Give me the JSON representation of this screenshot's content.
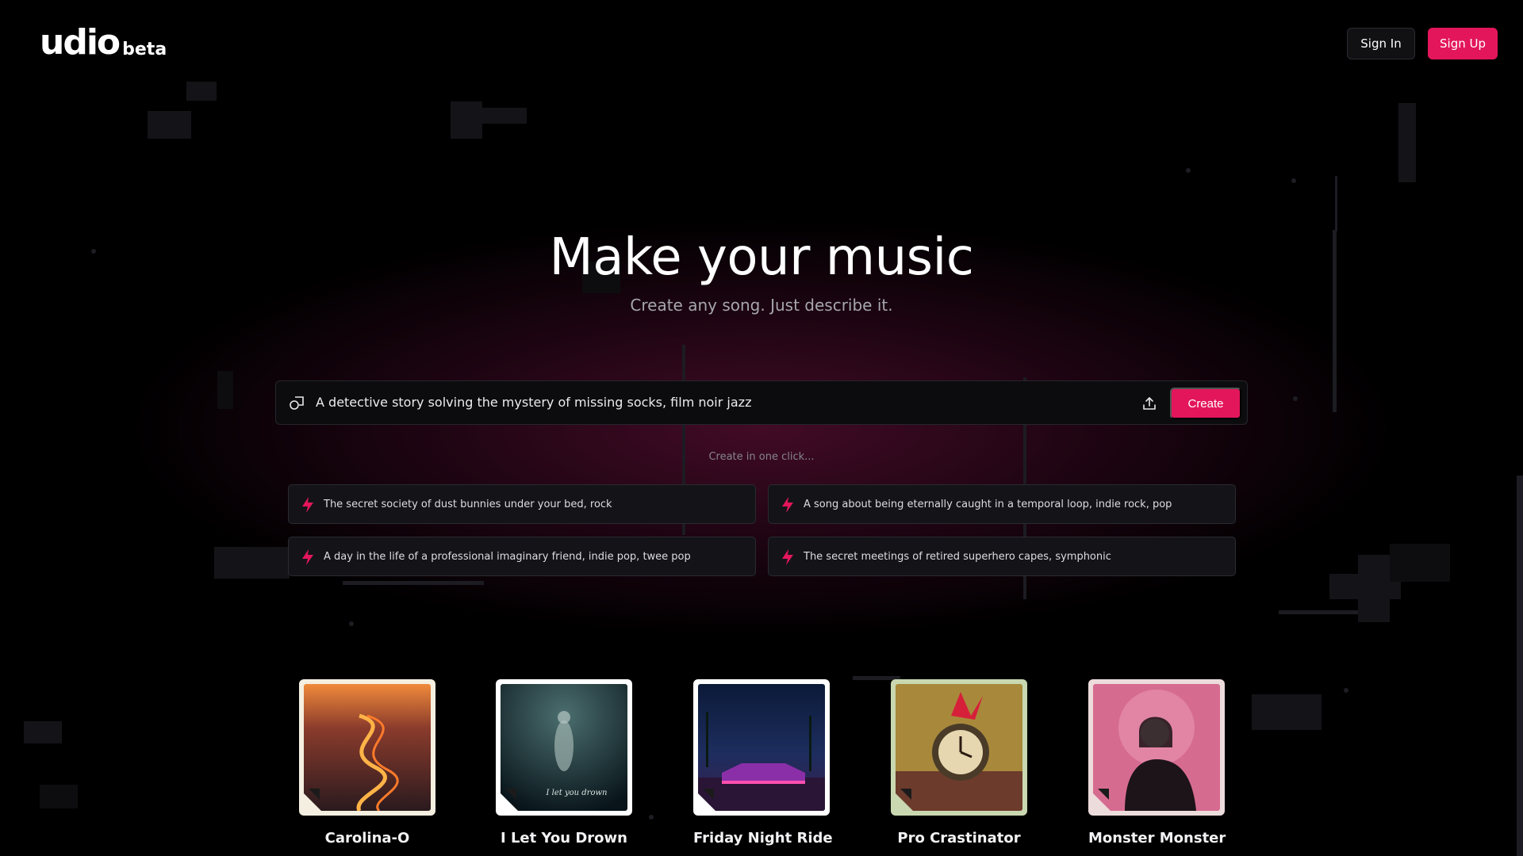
{
  "header": {
    "logo_text": "udio",
    "logo_badge": "beta",
    "signin_label": "Sign In",
    "signup_label": "Sign Up"
  },
  "hero": {
    "title": "Make your music",
    "subtitle": "Create any song. Just describe it."
  },
  "prompt": {
    "value": "A detective story solving the mystery of missing socks, film noir jazz",
    "create_label": "Create"
  },
  "one_click_label": "Create in one click...",
  "suggestions": [
    {
      "text": "The secret society of dust bunnies under your bed, rock"
    },
    {
      "text": "A song about being eternally caught in a temporal loop, indie rock, pop"
    },
    {
      "text": "A day in the life of a professional imaginary friend, indie pop, twee pop"
    },
    {
      "text": "The secret meetings of retired superhero capes, symphonic"
    }
  ],
  "songs": [
    {
      "title": "Carolina-O",
      "artist": "",
      "frame_color": "#f4efe0",
      "cover_top": "#e06a2b",
      "cover_bottom": "#2a1a1e"
    },
    {
      "title": "I Let You Drown",
      "artist": "",
      "frame_color": "#ffffff",
      "cover_top": "#2e4a4c",
      "cover_bottom": "#0b1819",
      "cover_text": "I let you drown"
    },
    {
      "title": "Friday Night Ride",
      "artist": "",
      "frame_color": "#ffffff",
      "cover_top": "#0f2140",
      "cover_bottom": "#7b2f8f"
    },
    {
      "title": "Pro Crastinator",
      "artist": "",
      "frame_color": "#c9d8b0",
      "cover_top": "#b99a3f",
      "cover_bottom": "#7a3a2a"
    },
    {
      "title": "Monster Monster",
      "artist": "",
      "frame_color": "#eddcdc",
      "cover_top": "#d76c91",
      "cover_bottom": "#2b1a20"
    }
  ],
  "colors": {
    "accent": "#e3165c",
    "background": "#000000"
  },
  "icons": {
    "prompt_left": "shapes-icon",
    "prompt_right": "upload-icon",
    "suggestion": "bolt-icon"
  }
}
